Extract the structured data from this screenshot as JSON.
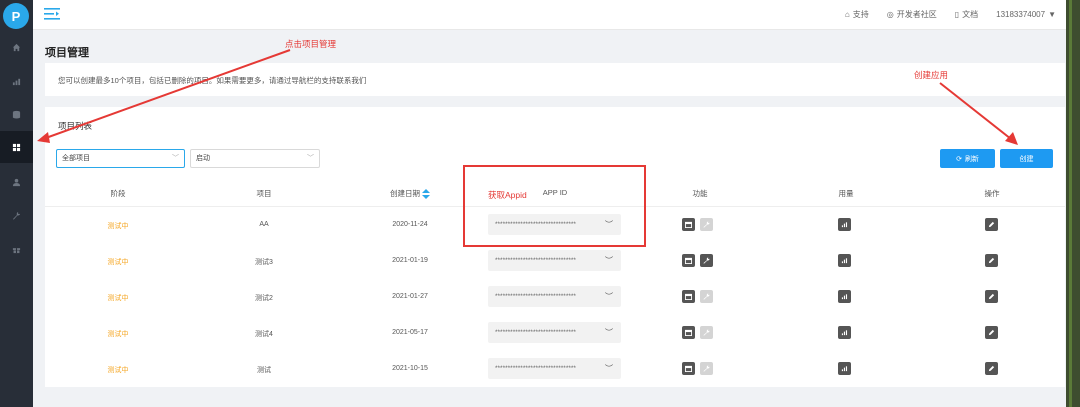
{
  "sidebar": {
    "logo_glyph": "P"
  },
  "topbar": {
    "links": [
      {
        "label": "支持",
        "icon": "support-icon"
      },
      {
        "label": "开发者社区",
        "icon": "community-icon"
      },
      {
        "label": "文档",
        "icon": "document-icon"
      }
    ],
    "account": "13183374007"
  },
  "page": {
    "title": "项目管理",
    "notice": "您可以创建最多10个项目，包括已删除的项目。如果需要更多，请通过导航栏的支持联系我们"
  },
  "list": {
    "title": "项目列表",
    "filter_scope": "全部项目",
    "filter_status": "启动",
    "refresh_label": "刷新",
    "create_label": "创建",
    "columns": [
      "阶段",
      "项目",
      "创建日期",
      "APP ID",
      "功能",
      "用量",
      "操作"
    ],
    "rows": [
      {
        "stage": "测试中",
        "project": "AA",
        "date": "2020-11-24",
        "appid": "********************************",
        "func2_enabled": false
      },
      {
        "stage": "测试中",
        "project": "测试3",
        "date": "2021-01-19",
        "appid": "********************************",
        "func2_enabled": true
      },
      {
        "stage": "测试中",
        "project": "测试2",
        "date": "2021-01-27",
        "appid": "********************************",
        "func2_enabled": false
      },
      {
        "stage": "测试中",
        "project": "测试4",
        "date": "2021-05-17",
        "appid": "********************************",
        "func2_enabled": false
      },
      {
        "stage": "测试中",
        "project": "测试",
        "date": "2021-10-15",
        "appid": "********************************",
        "func2_enabled": false
      }
    ]
  },
  "annotations": {
    "click_project": "点击项目管理",
    "create_app": "创建应用",
    "get_appid": "获取Appid"
  },
  "colors": {
    "accent": "#1e9af2",
    "stage": "#f5a623",
    "annotation": "#e53935",
    "sidebar": "#282e38"
  }
}
